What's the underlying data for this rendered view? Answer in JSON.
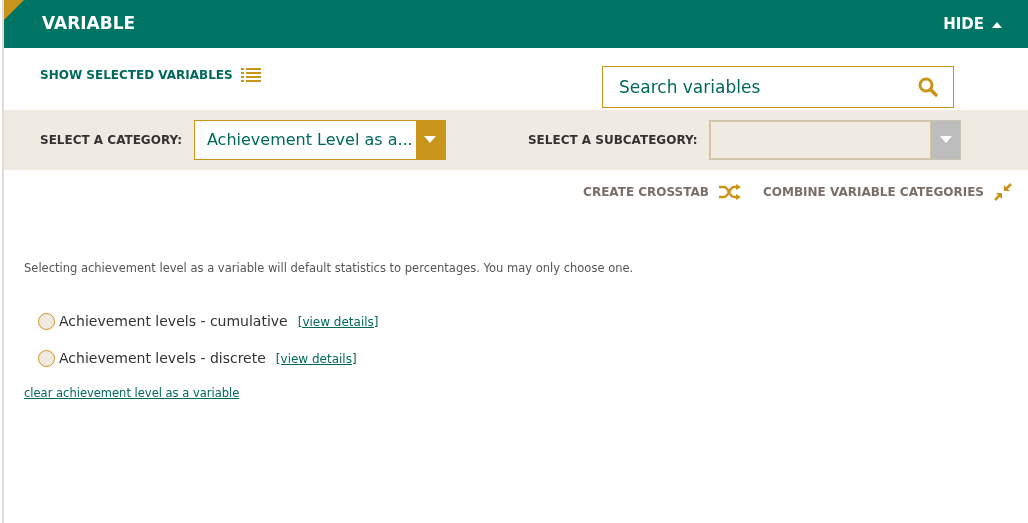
{
  "header": {
    "title": "VARIABLE",
    "toggle": "HIDE"
  },
  "show_selected": "SHOW SELECTED VARIABLES",
  "search": {
    "placeholder": "Search variables"
  },
  "category": {
    "label": "SELECT A CATEGORY:",
    "value": "Achievement Level as a...",
    "disabled": false
  },
  "subcategory": {
    "label": "SELECT A SUBCATEGORY:",
    "disabled": true
  },
  "actions": [
    {
      "kind": "crosstab",
      "label": "CREATE CROSSTAB"
    },
    {
      "kind": "combine",
      "label": "COMBINE VARIABLE CATEGORIES"
    }
  ],
  "note": "Selecting achievement level as a variable will default statistics to percentages. You may only choose one.",
  "options": [
    {
      "label": "Achievement levels - cumulative",
      "link": "[view details]",
      "selected": false
    },
    {
      "label": "Achievement levels - discrete",
      "link": "[view details]",
      "selected": false
    }
  ],
  "clear_link": "clear achievement level as a variable"
}
